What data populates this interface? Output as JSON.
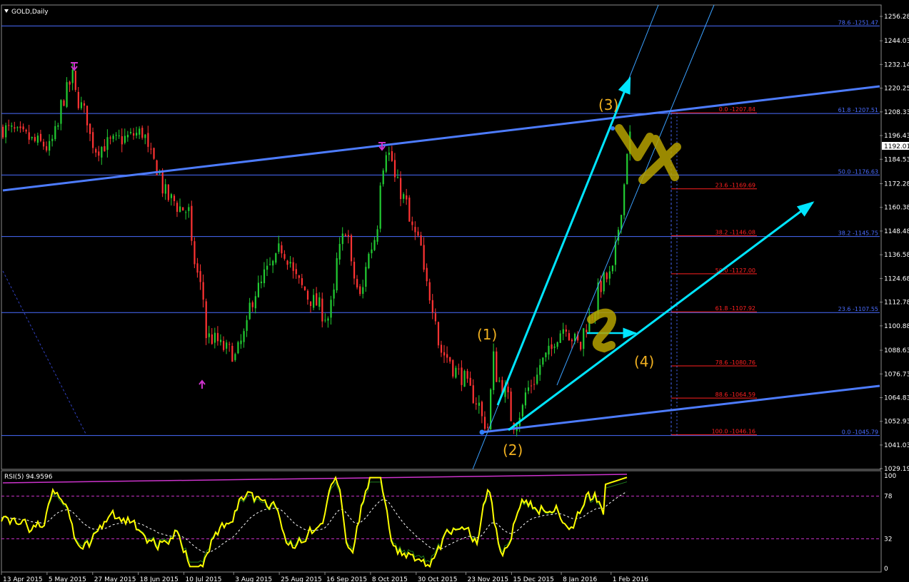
{
  "symbol_title": "GOLD,Daily",
  "rsi_title": "RSI(5) 94.9596",
  "current_price": "1192.01",
  "colors": {
    "background": "#000000",
    "bull_candle": "#22cc33",
    "bear_candle": "#ff3333",
    "fib_blue": "#4a6cff",
    "fib_red": "#ff2020",
    "trend_blue": "#4d7cff",
    "arrow_cyan": "#00e5ff",
    "wave_label": "#f0b020",
    "rsi_line": "#ffff00",
    "arrow_magenta": "#cc33cc",
    "annotation_olive": "#b5a100"
  },
  "chart_data": [
    {
      "type": "candlestick",
      "title": "GOLD,Daily",
      "ylim": [
        1029.19,
        1262.0
      ],
      "yticks": [
        "1256.28",
        "1244.03",
        "1232.14",
        "1220.25",
        "1208.33",
        "1196.43",
        "1184.53",
        "1172.28",
        "1160.38",
        "1148.48",
        "1136.58",
        "1124.68",
        "1112.78",
        "1100.88",
        "1088.63",
        "1076.73",
        "1064.83",
        "1052.93",
        "1041.03",
        "1029.19"
      ],
      "xticks": [
        "13 Apr 2015",
        "5 May 2015",
        "27 May 2015",
        "18 Jun 2015",
        "10 Jul 2015",
        "3 Aug 2015",
        "25 Aug 2015",
        "16 Sep 2015",
        "8 Oct 2015",
        "30 Oct 2015",
        "23 Nov 2015",
        "15 Dec 2015",
        "8 Jan 2016",
        "1 Feb 2016"
      ],
      "price_path": [
        [
          "13 Apr 2015",
          1200
        ],
        [
          "5 May 2015",
          1190
        ],
        [
          "15 May 2015",
          1226
        ],
        [
          "27 May 2015",
          1190
        ],
        [
          "18 Jun 2015",
          1198
        ],
        [
          "1 Jul 2015",
          1165
        ],
        [
          "10 Jul 2015",
          1158
        ],
        [
          "20 Jul 2015",
          1096
        ],
        [
          "3 Aug 2015",
          1085
        ],
        [
          "12 Aug 2015",
          1118
        ],
        [
          "25 Aug 2015",
          1140
        ],
        [
          "3 Sep 2015",
          1120
        ],
        [
          "16 Sep 2015",
          1105
        ],
        [
          "24 Sep 2015",
          1150
        ],
        [
          "1 Oct 2015",
          1115
        ],
        [
          "8 Oct 2015",
          1145
        ],
        [
          "14 Oct 2015",
          1190
        ],
        [
          "22 Oct 2015",
          1165
        ],
        [
          "30 Oct 2015",
          1140
        ],
        [
          "10 Nov 2015",
          1088
        ],
        [
          "23 Nov 2015",
          1070
        ],
        [
          "2 Dec 2015",
          1050
        ],
        [
          "4 Dec 2015",
          1085
        ],
        [
          "15 Dec 2015",
          1052
        ],
        [
          "23 Dec 2015",
          1072
        ],
        [
          "8 Jan 2016",
          1102
        ],
        [
          "15 Jan 2016",
          1090
        ],
        [
          "22 Jan 2016",
          1110
        ],
        [
          "27 Jan 2016",
          1124
        ],
        [
          "1 Feb 2016",
          1128
        ],
        [
          "5 Feb 2016",
          1172
        ],
        [
          "9 Feb 2016",
          1196
        ]
      ],
      "fib_blue_levels": [
        {
          "label": "78.6 -1251.47",
          "price": 1251.47
        },
        {
          "label": "61.8 -1207.51",
          "price": 1207.51
        },
        {
          "label": "50.0 -1176.63",
          "price": 1176.63
        },
        {
          "label": "38.2 -1145.75",
          "price": 1145.75
        },
        {
          "label": "23.6 -1107.55",
          "price": 1107.55
        },
        {
          "label": "0.0 -1045.79",
          "price": 1045.79
        }
      ],
      "fib_red_levels": [
        {
          "label": "0.0 -1207.84",
          "price": 1207.84
        },
        {
          "label": "23.6 -1169.69",
          "price": 1169.69
        },
        {
          "label": "38.2 -1146.08",
          "price": 1146.08
        },
        {
          "label": "50.0 -1127.00",
          "price": 1127.0
        },
        {
          "label": "61.8 -1107.92",
          "price": 1107.92
        },
        {
          "label": "78.6 -1080.76",
          "price": 1080.76
        },
        {
          "label": "88.6 -1064.59",
          "price": 1064.59
        },
        {
          "label": "100.0 -1046.16",
          "price": 1046.16
        }
      ],
      "wave_labels": [
        "(1)",
        "(2)",
        "(3)",
        "(4)"
      ],
      "annotation_marks": [
        "VX",
        "2"
      ]
    },
    {
      "type": "line",
      "title": "RSI(5) 94.9596",
      "ylim": [
        0,
        100
      ],
      "yticks": [
        "100",
        "78",
        "32",
        "0"
      ],
      "levels": [
        78,
        32
      ]
    }
  ]
}
